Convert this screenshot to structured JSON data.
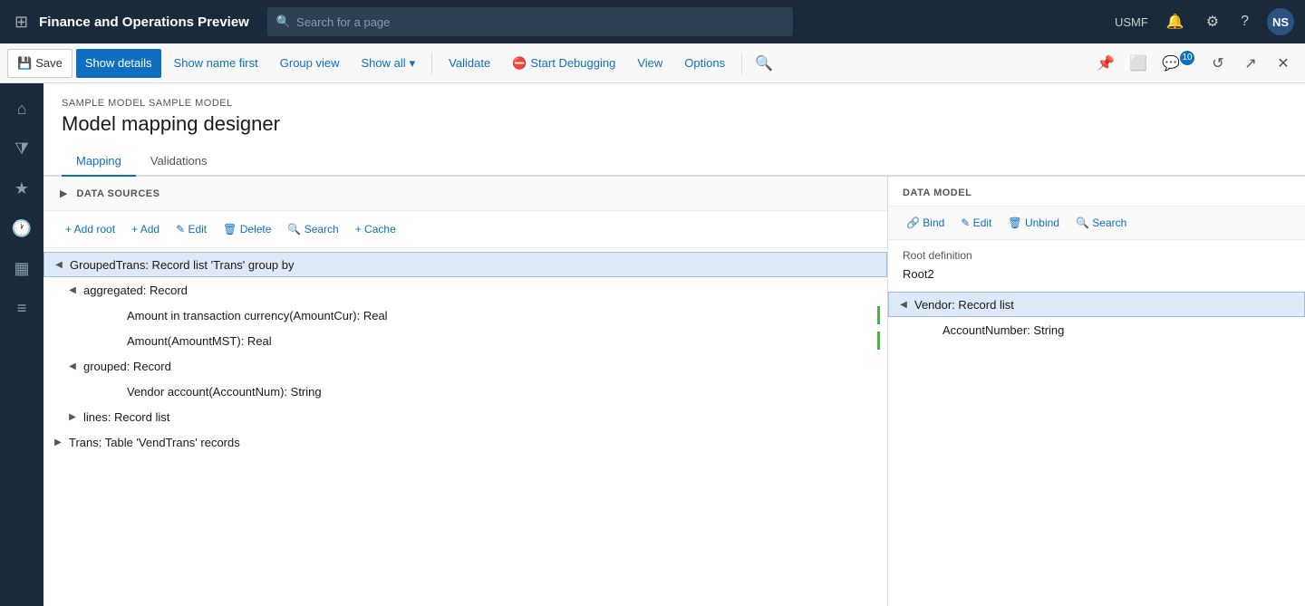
{
  "topNav": {
    "appTitle": "Finance and Operations Preview",
    "searchPlaceholder": "Search for a page",
    "userLabel": "USMF",
    "userInitials": "NS"
  },
  "toolbar": {
    "saveLabel": "Save",
    "showDetailsLabel": "Show details",
    "showNameFirstLabel": "Show name first",
    "groupViewLabel": "Group view",
    "showAllLabel": "Show all",
    "validateLabel": "Validate",
    "startDebuggingLabel": "Start Debugging",
    "viewLabel": "View",
    "optionsLabel": "Options"
  },
  "breadcrumb": "SAMPLE MODEL SAMPLE MODEL",
  "pageTitle": "Model mapping designer",
  "tabs": [
    {
      "label": "Mapping",
      "active": true
    },
    {
      "label": "Validations",
      "active": false
    }
  ],
  "dataSources": {
    "panelTitle": "DATA SOURCES",
    "toolbar": {
      "addRoot": "+ Add root",
      "add": "+ Add",
      "edit": "✎ Edit",
      "delete": "🗑 Delete",
      "search": "🔍 Search",
      "cache": "+ Cache"
    },
    "tree": [
      {
        "id": 1,
        "indent": 0,
        "label": "GroupedTrans: Record list 'Trans' group by",
        "expanded": true,
        "selected": true,
        "hasChildren": true
      },
      {
        "id": 2,
        "indent": 1,
        "label": "aggregated: Record",
        "expanded": true,
        "hasChildren": true
      },
      {
        "id": 3,
        "indent": 2,
        "label": "Amount in transaction currency(AmountCur): Real",
        "expanded": false,
        "hasChildren": false,
        "showBar": true
      },
      {
        "id": 4,
        "indent": 2,
        "label": "Amount(AmountMST): Real",
        "expanded": false,
        "hasChildren": false,
        "showBar": true
      },
      {
        "id": 5,
        "indent": 1,
        "label": "grouped: Record",
        "expanded": true,
        "hasChildren": true
      },
      {
        "id": 6,
        "indent": 2,
        "label": "Vendor account(AccountNum): String",
        "expanded": false,
        "hasChildren": false
      },
      {
        "id": 7,
        "indent": 1,
        "label": "lines: Record list",
        "expanded": false,
        "hasChildren": true,
        "collapsed": true
      },
      {
        "id": 8,
        "indent": 0,
        "label": "Trans: Table 'VendTrans' records",
        "expanded": false,
        "hasChildren": true,
        "collapsed": true
      }
    ]
  },
  "dataModel": {
    "sectionTitle": "DATA MODEL",
    "toolbar": {
      "bind": "🔗 Bind",
      "edit": "✎ Edit",
      "unbind": "🗑 Unbind",
      "search": "🔍 Search"
    },
    "rootDefinitionLabel": "Root definition",
    "rootDefinitionValue": "Root2",
    "tree": [
      {
        "id": 1,
        "indent": 0,
        "label": "Vendor: Record list",
        "expanded": true,
        "selected": true,
        "hasChildren": true
      },
      {
        "id": 2,
        "indent": 1,
        "label": "AccountNumber: String",
        "hasChildren": false
      }
    ]
  }
}
